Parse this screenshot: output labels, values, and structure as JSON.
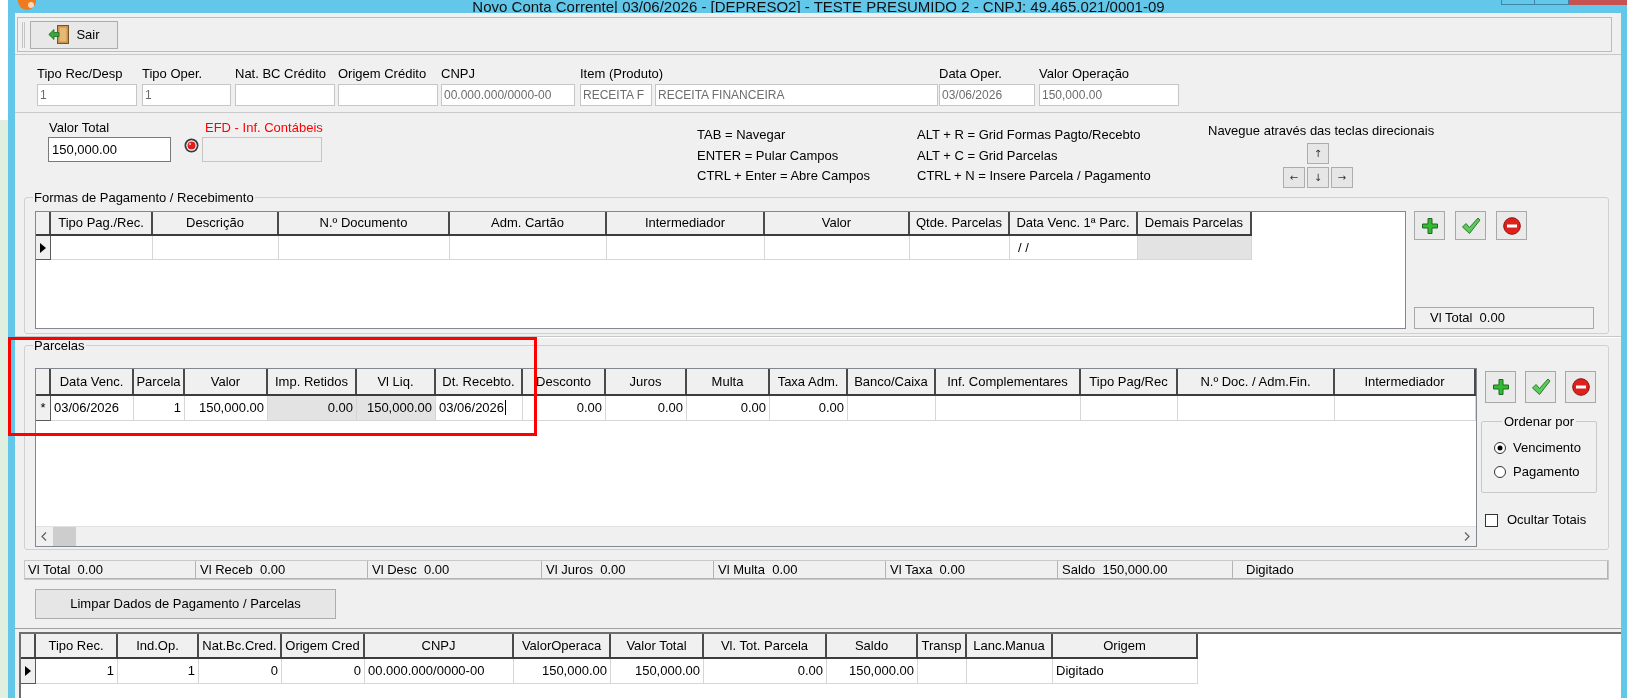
{
  "window": {
    "title": "Novo Conta Corrente| 03/06/2026 - [DEPRESO2] - TESTE PRESUMIDO 2 - CNPJ: 49.465.021/0001-09"
  },
  "toolbar": {
    "buttons": [
      {
        "kind": "exit",
        "label": "Sair"
      }
    ]
  },
  "header_fields": [
    {
      "label": "Tipo Rec/Desp",
      "value": "1",
      "readonly": true
    },
    {
      "label": "Tipo Oper.",
      "value": "1",
      "readonly": true
    },
    {
      "label": "Nat. BC Crédito",
      "readonly": true
    },
    {
      "label": "Origem Crédito",
      "readonly": true
    },
    {
      "label": "CNPJ",
      "value": "00.000.000/0000-00",
      "readonly": true
    },
    {
      "label": "Item (Produto)",
      "value": "RECEITA F",
      "readonly": true
    },
    {
      "value": "RECEITA FINANCEIRA",
      "readonly": true
    },
    {
      "label": "Data Oper.",
      "value": "03/06/2026",
      "readonly": true
    },
    {
      "label": "Valor Operação",
      "value": "150,000.00",
      "readonly": true
    }
  ],
  "valor_total": {
    "label": "Valor Total",
    "value": "150,000.00",
    "readonly": false
  },
  "efd": {
    "label": "EFD - Inf. Contábeis",
    "disabled": true
  },
  "shortcuts": [
    [
      "TAB = Navegar",
      "ENTER = Pular Campos",
      "CTRL + Enter = Abre Campos"
    ],
    [
      "ALT + R = Grid Formas Pagto/Recebto",
      "ALT + C = Grid Parcelas",
      "CTRL + N = Insere Parcela / Pagamento"
    ]
  ],
  "navigation": {
    "caption": "Navegue através das teclas direcionais",
    "keys": [
      "↑",
      "←",
      "↓",
      "→"
    ]
  },
  "payment_methods": {
    "title": "Formas de Pagamento / Recebimento",
    "table": {
      "columns": [
        {
          "label": "Tipo Pag./Rec.",
          "readonly": false
        },
        {
          "label": "Descrição",
          "readonly": false
        },
        {
          "label": "N.º Documento",
          "readonly": false
        },
        {
          "label": "Adm. Cartão",
          "readonly": false
        },
        {
          "label": "Intermediador",
          "readonly": false
        },
        {
          "label": "Valor",
          "readonly": false
        },
        {
          "label": "Qtde. Parcelas",
          "readonly": false
        },
        {
          "label": "Data Venc. 1ª Parc.",
          "readonly": false
        },
        {
          "label": "Demais Parcelas",
          "readonly": true
        }
      ],
      "rows": [
        {
          "indicator": {
            "kind": "pointer"
          },
          "cells": [
            null,
            null,
            null,
            null,
            null,
            null,
            null,
            "/ /",
            null
          ]
        }
      ]
    },
    "buttons": [
      {
        "kind": "add"
      },
      {
        "kind": "confirm"
      },
      {
        "kind": "remove"
      }
    ],
    "total": "Vl Total  0.00"
  },
  "installments": {
    "title": "Parcelas",
    "table": {
      "columns": [
        {
          "label": "Data Venc.",
          "readonly": false
        },
        {
          "label": "Parcela",
          "readonly": false
        },
        {
          "label": "Valor",
          "readonly": false
        },
        {
          "label": "Imp. Retidos",
          "readonly": true
        },
        {
          "label": "Vl Liq.",
          "readonly": true
        },
        {
          "label": "Dt. Recebto.",
          "readonly": false
        },
        {
          "label": "Desconto",
          "readonly": false
        },
        {
          "label": "Juros",
          "readonly": false
        },
        {
          "label": "Multa",
          "readonly": false
        },
        {
          "label": "Taxa Adm.",
          "readonly": false
        },
        {
          "label": "Banco/Caixa",
          "readonly": false
        },
        {
          "label": "Inf. Complementares",
          "readonly": false
        },
        {
          "label": "Tipo Pag/Rec",
          "readonly": false
        },
        {
          "label": "N.º Doc. / Adm.Fin.",
          "readonly": false
        },
        {
          "label": "Intermediador",
          "readonly": false
        }
      ],
      "rows": [
        {
          "indicator": {
            "kind": "text",
            "text": "*"
          },
          "cells": [
            {
              "text": "03/06/2026",
              "editing": false
            },
            {
              "text": "1",
              "editing": false
            },
            {
              "text": "150,000.00",
              "editing": false
            },
            {
              "text": "0.00",
              "editing": false
            },
            {
              "text": "150,000.00",
              "editing": false
            },
            {
              "text": "03/06/2026",
              "editing": true
            },
            {
              "text": "0.00",
              "editing": false
            },
            {
              "text": "0.00",
              "editing": false
            },
            {
              "text": "0.00",
              "editing": false
            },
            {
              "text": "0.00",
              "editing": false
            },
            {
              "editing": false
            },
            {
              "editing": false
            },
            {
              "editing": false
            },
            {
              "editing": false
            },
            {
              "editing": false
            }
          ]
        }
      ]
    },
    "buttons": [
      {
        "kind": "add"
      },
      {
        "kind": "confirm"
      },
      {
        "kind": "remove"
      }
    ],
    "sort_by": {
      "title": "Ordenar por",
      "options": [
        {
          "label": "Vencimento",
          "selected": true
        },
        {
          "label": "Pagamento",
          "selected": false
        }
      ]
    },
    "hide_totals": {
      "label": "Ocultar Totais",
      "checked": false
    }
  },
  "totals": [
    "Vl Total  0.00",
    "Vl Receb  0.00",
    "Vl Desc  0.00",
    "Vl Juros  0.00",
    "Vl Multa  0.00",
    "Vl Taxa  0.00",
    "Saldo  150,000.00",
    "Digitado"
  ],
  "clear_button": {
    "label": "Limpar Dados de Pagamento / Parcelas"
  },
  "summary_table": {
    "columns": [
      "Tipo Rec.",
      "Ind.Op.",
      "Nat.Bc.Cred.",
      "Origem Cred",
      "CNPJ",
      "ValorOperaca",
      "Valor Total",
      "Vl. Tot. Parcela",
      "Saldo",
      "Transp",
      "Lanc.Manua",
      "Origem"
    ],
    "rows": [
      {
        "indicator": {
          "kind": "pointer"
        },
        "cells": [
          "1",
          "1",
          "0",
          "0",
          "00.000.000/0000-00",
          "150,000.00",
          "150,000.00",
          "0.00",
          "150,000.00",
          null,
          null,
          "Digitado"
        ]
      }
    ]
  },
  "annotations": [
    {
      "kind": "rectangle"
    }
  ]
}
